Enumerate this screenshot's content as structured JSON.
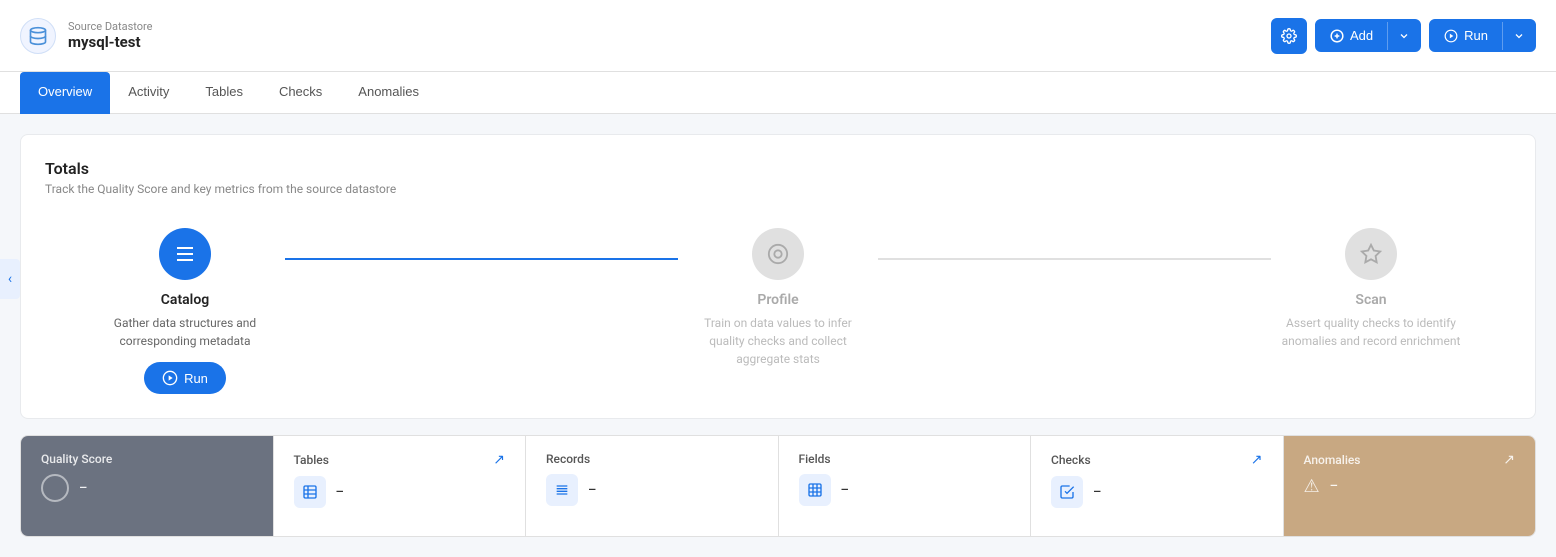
{
  "app": {
    "back_icon": "‹"
  },
  "header": {
    "datastore_type": "Source Datastore",
    "datastore_name": "mysql-test",
    "datastore_icon": "🔗",
    "settings_icon": "⚙",
    "add_label": "Add",
    "add_icon": "⊕",
    "run_label": "Run",
    "run_icon": "▶"
  },
  "nav": {
    "tabs": [
      {
        "id": "overview",
        "label": "Overview",
        "active": true
      },
      {
        "id": "activity",
        "label": "Activity",
        "active": false
      },
      {
        "id": "tables",
        "label": "Tables",
        "active": false
      },
      {
        "id": "checks",
        "label": "Checks",
        "active": false
      },
      {
        "id": "anomalies",
        "label": "Anomalies",
        "active": false
      }
    ]
  },
  "totals": {
    "title": "Totals",
    "subtitle": "Track the Quality Score and key metrics from the source datastore"
  },
  "pipeline": {
    "steps": [
      {
        "id": "catalog",
        "name": "Catalog",
        "icon": "☰",
        "active": true,
        "description": "Gather data structures and corresponding metadata",
        "show_run": true,
        "run_label": "Run"
      },
      {
        "id": "profile",
        "name": "Profile",
        "icon": "◎",
        "active": false,
        "description": "Train on data values to infer quality checks and collect aggregate stats",
        "show_run": false,
        "run_label": ""
      },
      {
        "id": "scan",
        "name": "Scan",
        "icon": "⬡",
        "active": false,
        "description": "Assert quality checks to identify anomalies and record enrichment",
        "show_run": false,
        "run_label": ""
      }
    ],
    "connector1_active": true,
    "connector2_active": false
  },
  "metrics": [
    {
      "id": "quality-score",
      "title": "Quality Score",
      "value": "–",
      "icon": "circle",
      "type": "quality",
      "show_arrow": false
    },
    {
      "id": "tables",
      "title": "Tables",
      "value": "–",
      "icon": "grid",
      "type": "standard",
      "show_arrow": true
    },
    {
      "id": "records",
      "title": "Records",
      "value": "–",
      "icon": "list",
      "type": "standard",
      "show_arrow": false
    },
    {
      "id": "fields",
      "title": "Fields",
      "value": "–",
      "icon": "columns",
      "type": "standard",
      "show_arrow": false
    },
    {
      "id": "checks",
      "title": "Checks",
      "value": "–",
      "icon": "check",
      "type": "standard",
      "show_arrow": true
    },
    {
      "id": "anomalies",
      "title": "Anomalies",
      "value": "–",
      "icon": "triangle",
      "type": "anomaly",
      "show_arrow": true
    }
  ]
}
